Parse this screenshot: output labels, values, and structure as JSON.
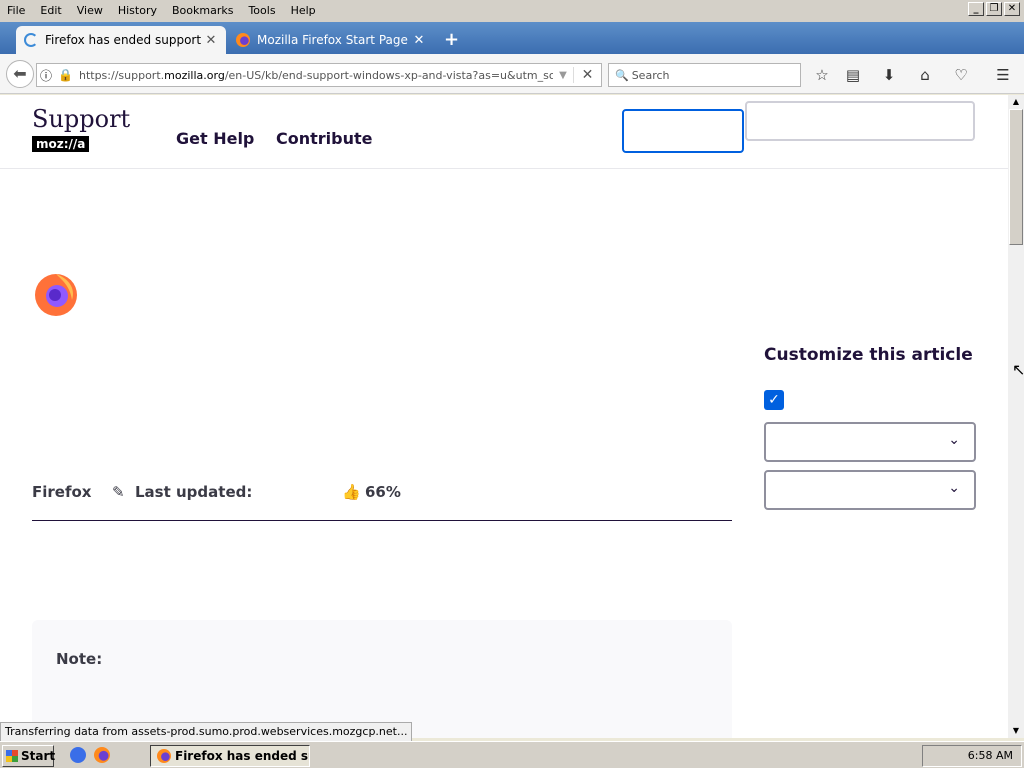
{
  "menubar": {
    "items": [
      "File",
      "Edit",
      "View",
      "History",
      "Bookmarks",
      "Tools",
      "Help"
    ]
  },
  "tabs": [
    {
      "label": "Firefox has ended support fo...",
      "state": "loading"
    },
    {
      "label": "Mozilla Firefox Start Page"
    }
  ],
  "toolbar": {
    "url_pre": "https://support.",
    "url_host": "mozilla.org",
    "url_post": "/en-US/kb/end-support-windows-xp-and-vista?as=u&utm_source=ir",
    "search_placeholder": "Search"
  },
  "site": {
    "logo_text": "Support",
    "logo_brand": "moz://a",
    "nav": [
      "Get Help",
      "Contribute"
    ]
  },
  "article": {
    "product": "Firefox",
    "last_updated": "Last updated:",
    "helpful_pct": "66%",
    "note_label": "Note:"
  },
  "sidebar": {
    "title": "Customize this article",
    "checked": true
  },
  "status_text": "Transferring data from assets-prod.sumo.prod.webservices.mozgcp.net...",
  "taskbar": {
    "start": "Start",
    "task": "Firefox has ended sup...",
    "clock": "6:58 AM"
  },
  "colors": {
    "accent": "#0060df",
    "text": "#20123a"
  }
}
